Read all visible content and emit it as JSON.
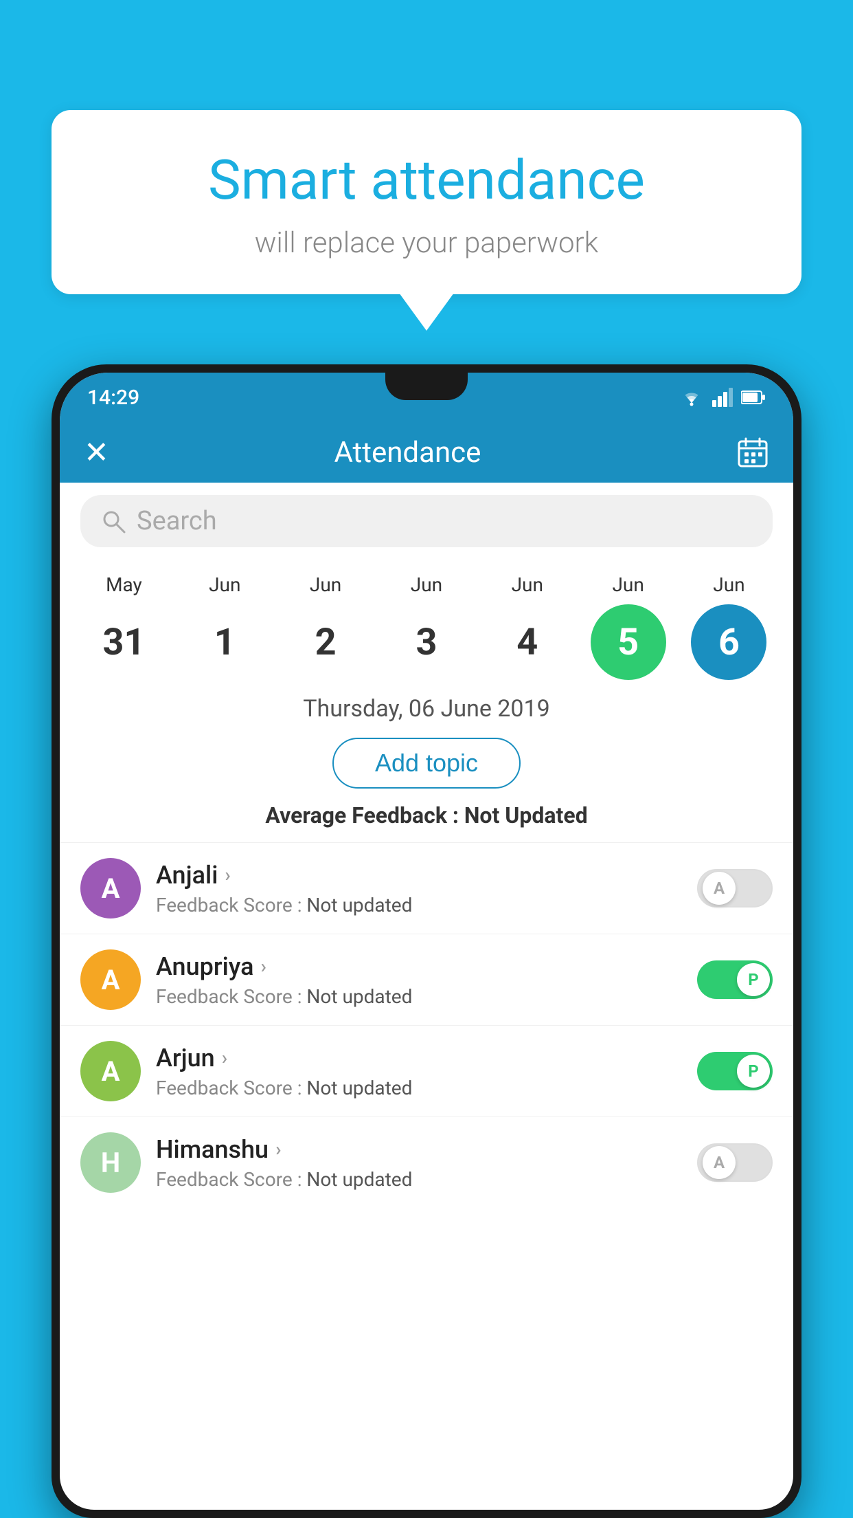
{
  "page": {
    "background_color": "#1BB8E8"
  },
  "speech_bubble": {
    "headline": "Smart attendance",
    "subtext": "will replace your paperwork"
  },
  "status_bar": {
    "time": "14:29"
  },
  "app_bar": {
    "title": "Attendance",
    "close_label": "✕",
    "calendar_label": "📅"
  },
  "search": {
    "placeholder": "Search"
  },
  "calendar": {
    "days": [
      {
        "month": "May",
        "date": "31",
        "style": "normal"
      },
      {
        "month": "Jun",
        "date": "1",
        "style": "normal"
      },
      {
        "month": "Jun",
        "date": "2",
        "style": "normal"
      },
      {
        "month": "Jun",
        "date": "3",
        "style": "normal"
      },
      {
        "month": "Jun",
        "date": "4",
        "style": "normal"
      },
      {
        "month": "Jun",
        "date": "5",
        "style": "today"
      },
      {
        "month": "Jun",
        "date": "6",
        "style": "selected"
      }
    ],
    "selected_date_label": "Thursday, 06 June 2019"
  },
  "add_topic_button": "Add topic",
  "average_feedback": {
    "label": "Average Feedback : ",
    "value": "Not Updated"
  },
  "students": [
    {
      "name": "Anjali",
      "avatar_letter": "A",
      "avatar_color": "#9C59B6",
      "feedback": "Feedback Score : ",
      "feedback_value": "Not updated",
      "toggle": "off",
      "toggle_letter": "A"
    },
    {
      "name": "Anupriya",
      "avatar_letter": "A",
      "avatar_color": "#F5A623",
      "feedback": "Feedback Score : ",
      "feedback_value": "Not updated",
      "toggle": "on",
      "toggle_letter": "P"
    },
    {
      "name": "Arjun",
      "avatar_letter": "A",
      "avatar_color": "#8BC34A",
      "feedback": "Feedback Score : ",
      "feedback_value": "Not updated",
      "toggle": "on",
      "toggle_letter": "P"
    },
    {
      "name": "Himanshu",
      "avatar_letter": "H",
      "avatar_color": "#A5D6A7",
      "feedback": "Feedback Score : ",
      "feedback_value": "Not updated",
      "toggle": "off",
      "toggle_letter": "A"
    }
  ]
}
